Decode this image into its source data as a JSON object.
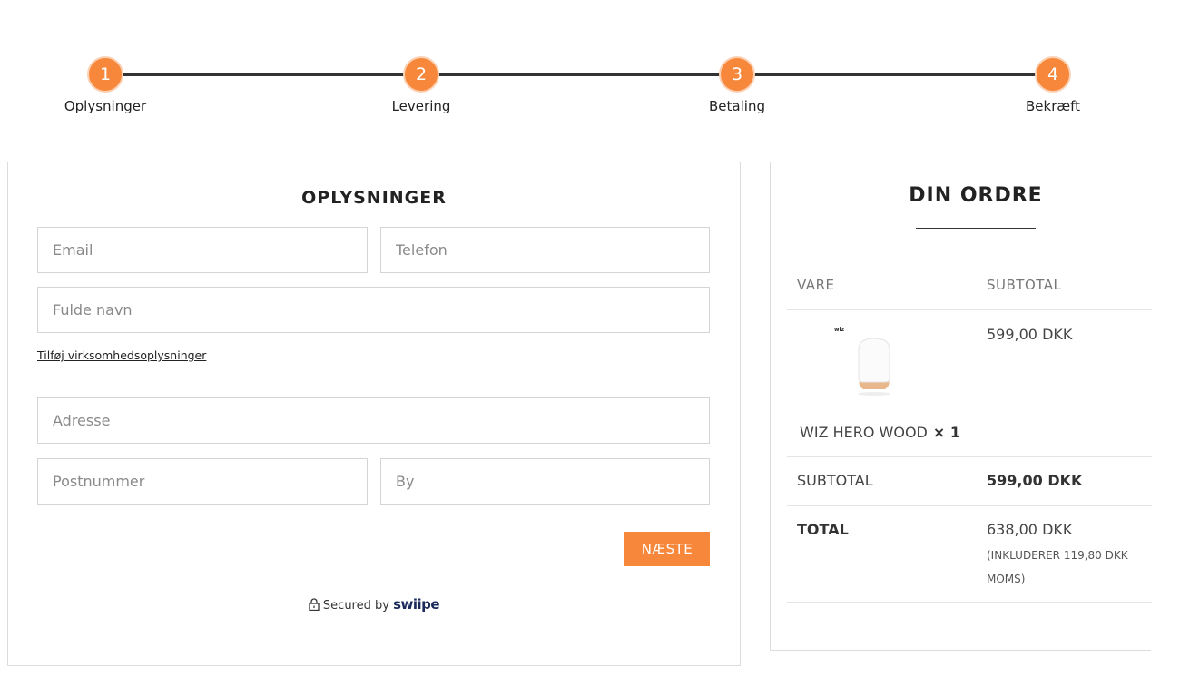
{
  "colors": {
    "accent": "#f7873a",
    "brand_dark": "#1a2b5c"
  },
  "stepper": {
    "steps": [
      {
        "number": "1",
        "label": "Oplysninger"
      },
      {
        "number": "2",
        "label": "Levering"
      },
      {
        "number": "3",
        "label": "Betaling"
      },
      {
        "number": "4",
        "label": "Bekræft"
      }
    ]
  },
  "form": {
    "title": "OPLYSNINGER",
    "fields": {
      "email": {
        "placeholder": "Email",
        "value": ""
      },
      "phone": {
        "placeholder": "Telefon",
        "value": ""
      },
      "full_name": {
        "placeholder": "Fulde navn",
        "value": ""
      },
      "address": {
        "placeholder": "Adresse",
        "value": ""
      },
      "postal_code": {
        "placeholder": "Postnummer",
        "value": ""
      },
      "city": {
        "placeholder": "By",
        "value": ""
      }
    },
    "business_link": "Tilføj virksomhedsoplysninger",
    "next_button": "NÆSTE",
    "secured_text": "Secured by",
    "secured_brand": "swiipe",
    "lock_icon": "lock-icon"
  },
  "order": {
    "title": "DIN ORDRE",
    "col_item": "VARE",
    "col_subtotal": "SUBTOTAL",
    "product": {
      "brand_mark": "wiz",
      "name": "WIZ HERO WOOD",
      "qty": "× 1",
      "price": "599,00 DKK"
    },
    "subtotal_label": "SUBTOTAL",
    "subtotal_value": "599,00 DKK",
    "total_label": "TOTAL",
    "total_value": "638,00 DKK",
    "total_note": "(INKLUDERER 119,80 DKK MOMS)"
  }
}
